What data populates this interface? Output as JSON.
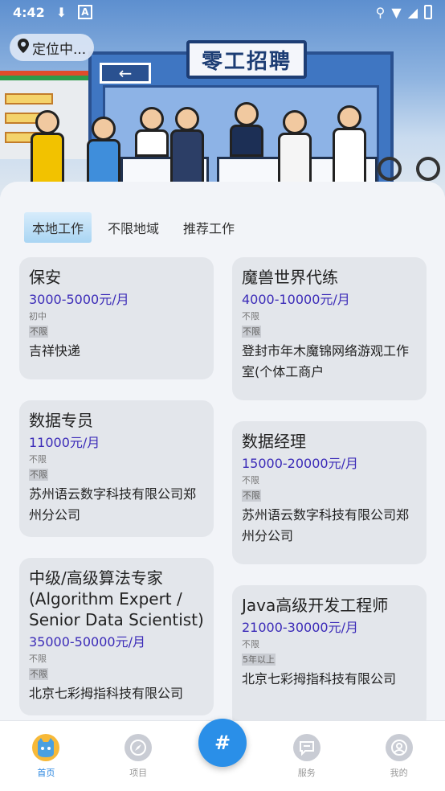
{
  "status": {
    "time": "4:42"
  },
  "location": {
    "label": "定位中..."
  },
  "banner": {
    "sign": "零工招聘"
  },
  "tabs": [
    {
      "label": "本地工作",
      "active": true
    },
    {
      "label": "不限地域",
      "active": false
    },
    {
      "label": "推荐工作",
      "active": false
    }
  ],
  "jobs_left": [
    {
      "title": "保安",
      "salary": "3000-5000元/月",
      "education": "初中",
      "experience": "不限",
      "company": "吉祥快递"
    },
    {
      "title": "数据专员",
      "salary": "11000元/月",
      "education": "不限",
      "experience": "不限",
      "company": "苏州语云数字科技有限公司郑州分公司"
    },
    {
      "title": "中级/高级算法专家(Algorithm Expert / Senior Data Scientist)",
      "salary": "35000-50000元/月",
      "education": "不限",
      "experience": "不限",
      "company": "北京七彩拇指科技有限公司"
    }
  ],
  "jobs_right": [
    {
      "title": "魔兽世界代练",
      "salary": "4000-10000元/月",
      "education": "不限",
      "experience": "不限",
      "company": "登封市年木魔锦网络游观工作室(个体工商户"
    },
    {
      "title": "数据经理",
      "salary": "15000-20000元/月",
      "education": "不限",
      "experience": "不限",
      "company": "苏州语云数字科技有限公司郑州分公司"
    },
    {
      "title": "Java高级开发工程师",
      "salary": "21000-30000元/月",
      "education": "不限",
      "experience": "5年以上",
      "company": "北京七彩拇指科技有限公司"
    }
  ],
  "nav": [
    {
      "label": "首页",
      "icon": "cat-icon",
      "active": true
    },
    {
      "label": "项目",
      "icon": "compass-icon",
      "active": false
    },
    {
      "label": "服务",
      "icon": "chat-icon",
      "active": false
    },
    {
      "label": "我的",
      "icon": "profile-icon",
      "active": false
    }
  ],
  "fab": {
    "label": "#"
  },
  "colors": {
    "accent": "#2a8fe8",
    "salary": "#3b2bb8",
    "nav_active": "#2a86e0"
  }
}
